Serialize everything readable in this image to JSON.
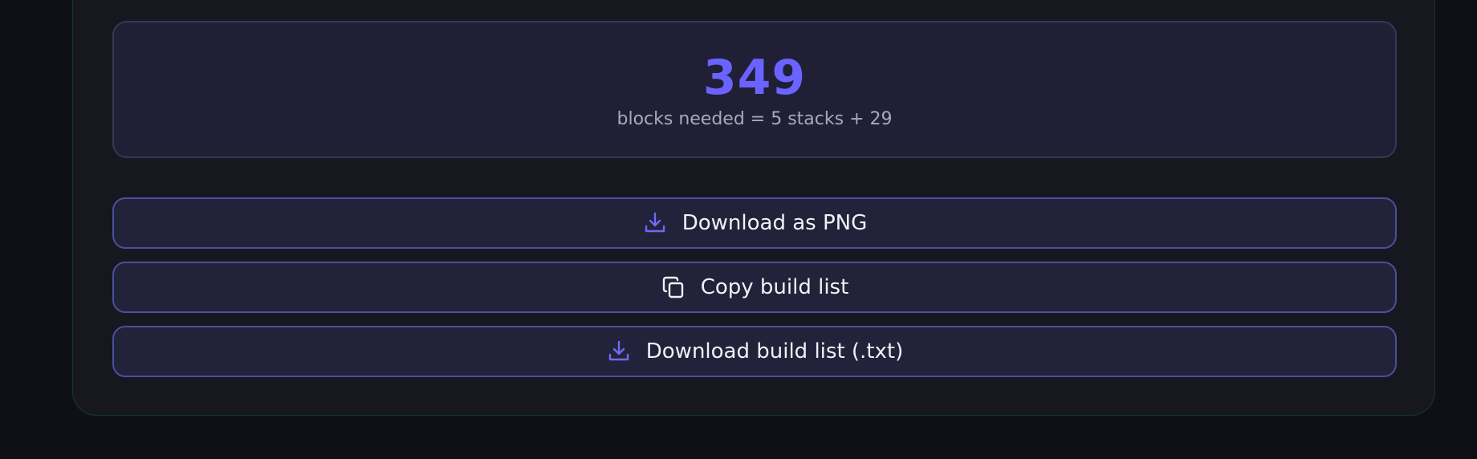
{
  "summary": {
    "value": "349",
    "caption": "blocks needed = 5 stacks + 29"
  },
  "actions": {
    "download_png": {
      "label": "Download as PNG",
      "icon": "download-icon"
    },
    "copy_list": {
      "label": "Copy build list",
      "icon": "copy-icon"
    },
    "download_txt": {
      "label": "Download build list (.txt)",
      "icon": "download-icon"
    }
  },
  "colors": {
    "accent": "#6b63ff",
    "panel_border": "#123a2c",
    "button_border": "#4b4f9e",
    "button_bg": "#22223a"
  }
}
